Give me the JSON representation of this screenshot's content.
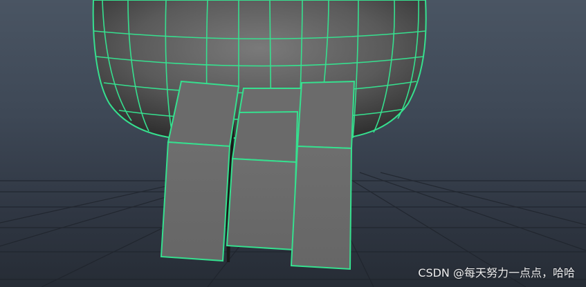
{
  "viewport": {
    "background_top": "#4a5563",
    "background_bottom": "#262c35",
    "grid_color": "#1f242c",
    "wire_color": "#36e08f",
    "face_color": "#6b6b6b",
    "body_dark": "#3e3e3e"
  },
  "watermark": {
    "text": "CSDN @每天努力一点点，哈哈"
  }
}
